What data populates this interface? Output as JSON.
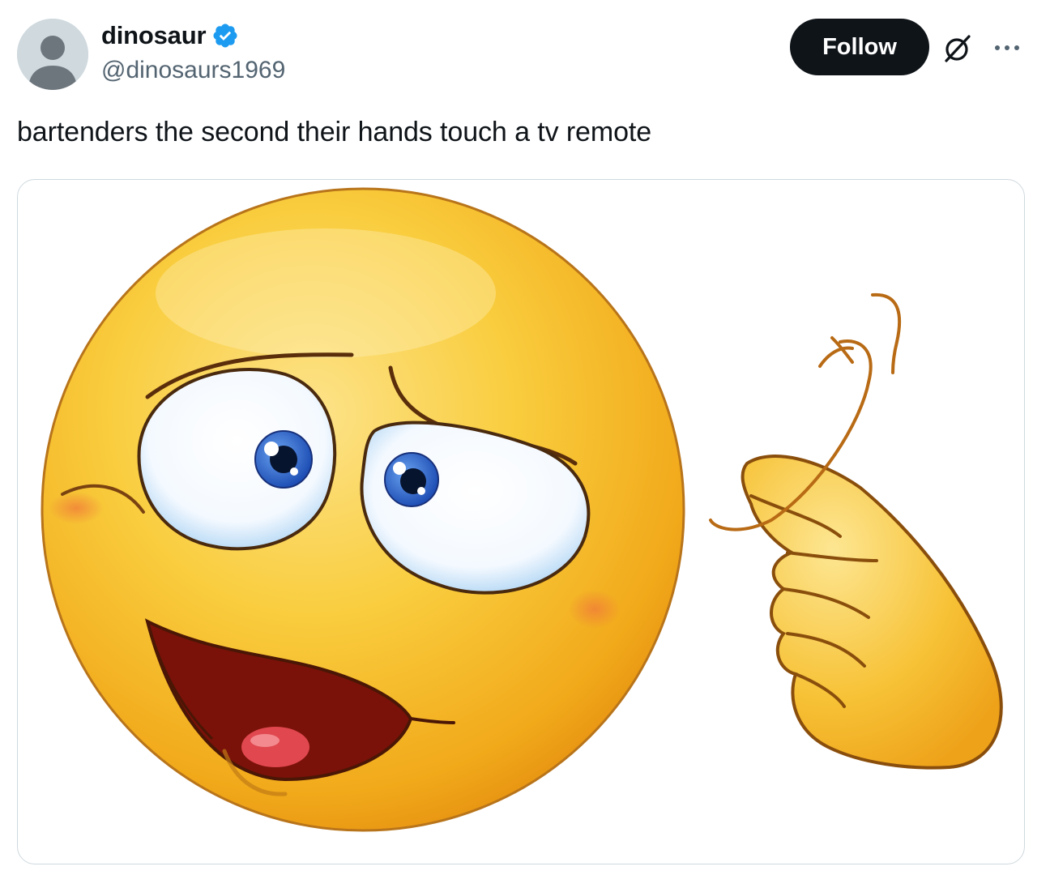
{
  "author": {
    "display_name": "dinosaur",
    "handle": "@dinosaurs1969",
    "verified": true,
    "avatar_icon": "default-avatar-icon"
  },
  "actions": {
    "follow_label": "Follow",
    "grok_icon": "grok-icon",
    "more_icon": "more-icon"
  },
  "tweet": {
    "text": "bartenders the second their hands touch a tv remote"
  },
  "media": {
    "alt": "crazy emoji face with finger twirling near its head",
    "icon": "crazy-emoji-image"
  },
  "colors": {
    "verified_blue": "#1d9bf0",
    "follow_bg": "#0f1419",
    "text_primary": "#0f1419",
    "text_secondary": "#536471",
    "emoji_yellow": "#f7c02b"
  }
}
